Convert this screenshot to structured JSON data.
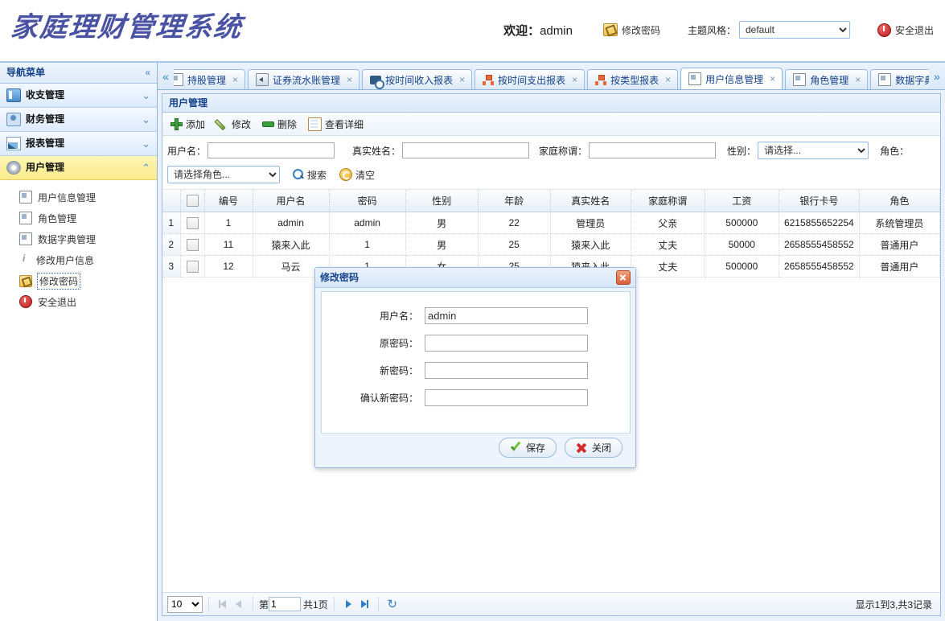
{
  "header": {
    "title": "家庭理财管理系统",
    "welcome_label": "欢迎：",
    "username": "admin",
    "change_password_label": "修改密码",
    "theme_label": "主题风格：",
    "theme_value": "default",
    "logout_label": "安全退出"
  },
  "sidebar": {
    "heading": "导航菜单",
    "collapse_glyph": "«",
    "groups": [
      {
        "label": "收支管理",
        "icon": "income-icon",
        "expanded": false,
        "chevron": "⌄"
      },
      {
        "label": "财务管理",
        "icon": "finance-icon",
        "expanded": false,
        "chevron": "⌄"
      },
      {
        "label": "报表管理",
        "icon": "report-icon",
        "expanded": false,
        "chevron": "⌄"
      },
      {
        "label": "用户管理",
        "icon": "user-gear-icon",
        "expanded": true,
        "chevron": "⌃"
      }
    ],
    "sub_items": [
      {
        "label": "用户信息管理",
        "icon": "doc-icon",
        "focused": false
      },
      {
        "label": "角色管理",
        "icon": "doc-icon",
        "focused": false
      },
      {
        "label": "数据字典管理",
        "icon": "doc-icon",
        "focused": false
      },
      {
        "label": "修改用户信息",
        "icon": "info-icon",
        "focused": false
      },
      {
        "label": "修改密码",
        "icon": "key-icon",
        "focused": true
      },
      {
        "label": "安全退出",
        "icon": "power-icon",
        "focused": false
      }
    ]
  },
  "tabs": {
    "scroll_left_glyph": "«",
    "scroll_right_glyph": "»",
    "items": [
      {
        "label": "持股管理",
        "icon": "doc-icon",
        "active": false,
        "close": "×"
      },
      {
        "label": "证券流水账管理",
        "icon": "left-arrow-icon",
        "active": false,
        "close": "×"
      },
      {
        "label": "按时间收入报表",
        "icon": "clock-icon",
        "active": false,
        "close": "×"
      },
      {
        "label": "按时间支出报表",
        "icon": "org-chart-icon",
        "active": false,
        "close": "×"
      },
      {
        "label": "按类型报表",
        "icon": "org-chart-icon",
        "active": false,
        "close": "×"
      },
      {
        "label": "用户信息管理",
        "icon": "doc-icon",
        "active": true,
        "close": "×"
      },
      {
        "label": "角色管理",
        "icon": "doc-icon",
        "active": false,
        "close": "×"
      },
      {
        "label": "数据字典管理",
        "icon": "doc-icon",
        "active": false,
        "close": "×"
      }
    ]
  },
  "panel": {
    "title": "用户管理",
    "toolbar": [
      {
        "label": "添加",
        "icon": "add-icon"
      },
      {
        "label": "修改",
        "icon": "edit-pencil-icon"
      },
      {
        "label": "删除",
        "icon": "delete-icon"
      },
      {
        "label": "查看详细",
        "icon": "detail-clipboard-icon"
      }
    ],
    "filters": {
      "username_label": "用户名：",
      "username_value": "",
      "realname_label": "真实姓名：",
      "realname_value": "",
      "family_title_label": "家庭称谓：",
      "family_title_value": "",
      "gender_label": "性别：",
      "gender_value": "请选择...",
      "role_label": "角色：",
      "role_value": "请选择角色...",
      "search_label": "搜索",
      "clear_label": "清空"
    }
  },
  "table": {
    "columns": [
      "",
      "",
      "编号",
      "用户名",
      "密码",
      "性别",
      "年龄",
      "真实姓名",
      "家庭称谓",
      "工资",
      "银行卡号",
      "角色"
    ],
    "rows": [
      {
        "no": "1",
        "id": "1",
        "username": "admin",
        "password": "admin",
        "gender": "男",
        "age": "22",
        "realname": "管理员",
        "family_title": "父亲",
        "salary": "500000",
        "bankcard": "6215855652254",
        "role": "系统管理员"
      },
      {
        "no": "2",
        "id": "11",
        "username": "猿来入此",
        "password": "1",
        "gender": "男",
        "age": "25",
        "realname": "猿来入此",
        "family_title": "丈夫",
        "salary": "50000",
        "bankcard": "2658555458552",
        "role": "普通用户"
      },
      {
        "no": "3",
        "id": "12",
        "username": "马云",
        "password": "1",
        "gender": "女",
        "age": "25",
        "realname": "猿来入此",
        "family_title": "丈夫",
        "salary": "500000",
        "bankcard": "2658555458552",
        "role": "普通用户"
      }
    ]
  },
  "pager": {
    "page_size": "10",
    "first_icon": "first-page-icon",
    "prev_icon": "prev-page-icon",
    "page_prefix": "第",
    "page_number": "1",
    "page_total": "共1页",
    "next_icon": "next-page-icon",
    "last_icon": "last-page-icon",
    "refresh_glyph": "↻",
    "info": "显示1到3,共3记录"
  },
  "modal": {
    "title": "修改密码",
    "close_glyph": "×",
    "fields": [
      {
        "label": "用户名：",
        "value": "admin"
      },
      {
        "label": "原密码：",
        "value": ""
      },
      {
        "label": "新密码：",
        "value": ""
      },
      {
        "label": "确认新密码：",
        "value": ""
      }
    ],
    "save_label": "保存",
    "close_label": "关闭"
  }
}
